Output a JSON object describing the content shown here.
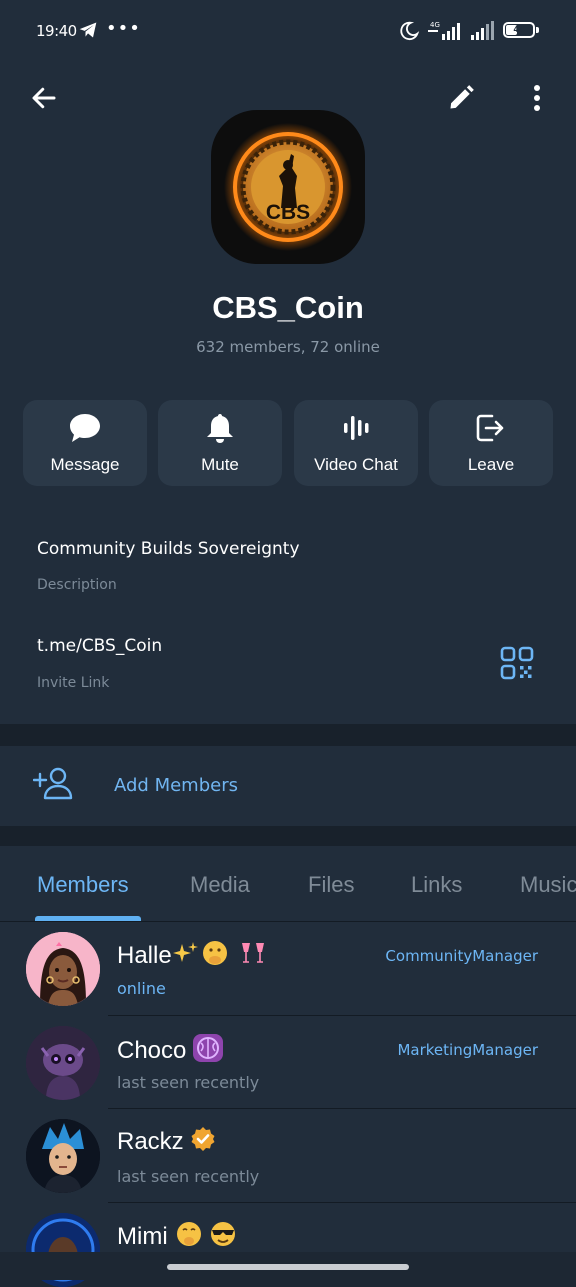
{
  "status_bar": {
    "time": "19:40",
    "network": "4G",
    "battery": "44",
    "battery_level": 0.44
  },
  "header": {
    "title": "CBS_Coin",
    "subtitle": "632 members, 72 online",
    "avatar_text": "CBS"
  },
  "actions": [
    {
      "label": "Message",
      "icon": "message-bubble-icon"
    },
    {
      "label": "Mute",
      "icon": "bell-icon"
    },
    {
      "label": "Video Chat",
      "icon": "voice-wave-icon"
    },
    {
      "label": "Leave",
      "icon": "leave-icon"
    }
  ],
  "info": {
    "description": "Community Builds Sovereignty",
    "description_label": "Description",
    "link": "t.me/CBS_Coin",
    "link_label": "Invite Link"
  },
  "add_members": {
    "label": "Add Members"
  },
  "tabs": [
    {
      "label": "Members",
      "active": true
    },
    {
      "label": "Media"
    },
    {
      "label": "Files"
    },
    {
      "label": "Links"
    },
    {
      "label": "Music"
    }
  ],
  "members": [
    {
      "name": "Halle",
      "status": "online",
      "role": "CommunityManager"
    },
    {
      "name": "Choco",
      "status": "last seen recently",
      "role": "MarketingManager"
    },
    {
      "name": "Rackz",
      "status": "last seen recently",
      "role": ""
    },
    {
      "name": "Mimi",
      "status": "",
      "role": ""
    }
  ],
  "colors": {
    "accent": "#6db6f5",
    "background": "#1d2733",
    "panel": "#212d3b",
    "button": "#2b3948"
  }
}
